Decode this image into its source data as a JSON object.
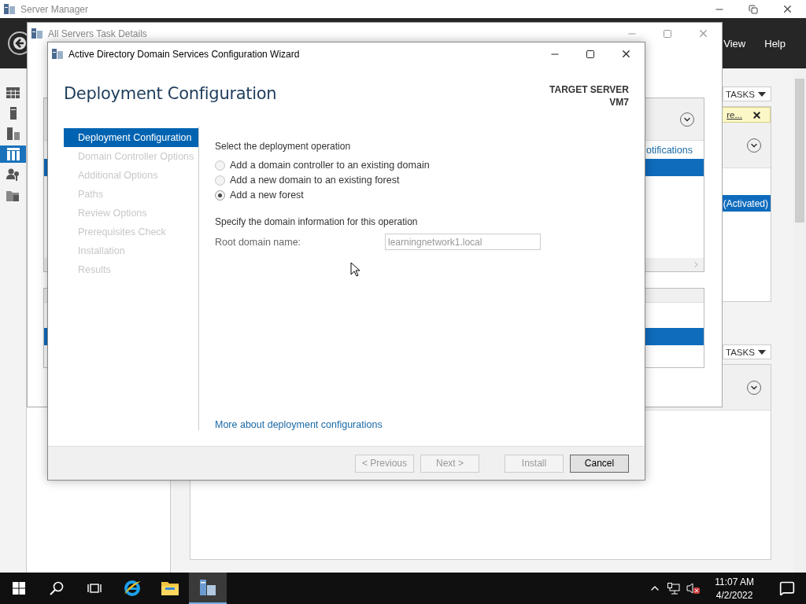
{
  "server_manager": {
    "title": "Server Manager",
    "menu": [
      "View",
      "Help"
    ],
    "nav_items": [
      {
        "kind": "dashboard",
        "selected": false
      },
      {
        "kind": "server",
        "selected": false
      },
      {
        "kind": "servers",
        "selected": false
      },
      {
        "kind": "directory",
        "selected": true
      },
      {
        "kind": "users",
        "selected": false
      },
      {
        "kind": "files",
        "selected": false
      }
    ],
    "tiles": [
      {
        "tasks": "TASKS",
        "notice": "re...",
        "highlight": "(Activated)"
      },
      {
        "tasks": "TASKS"
      }
    ]
  },
  "task_details": {
    "title": "All Servers Task Details",
    "link": "otifications"
  },
  "wizard": {
    "title": "Active Directory Domain Services Configuration Wizard",
    "heading": "Deployment Configuration",
    "target_label": "TARGET SERVER",
    "target_name": "VM7",
    "steps": [
      {
        "label": "Deployment Configuration",
        "selected": true,
        "disabled": false
      },
      {
        "label": "Domain Controller Options",
        "selected": false,
        "disabled": true
      },
      {
        "label": "Additional Options",
        "selected": false,
        "disabled": true
      },
      {
        "label": "Paths",
        "selected": false,
        "disabled": true
      },
      {
        "label": "Review Options",
        "selected": false,
        "disabled": true
      },
      {
        "label": "Prerequisites Check",
        "selected": false,
        "disabled": true
      },
      {
        "label": "Installation",
        "selected": false,
        "disabled": true
      },
      {
        "label": "Results",
        "selected": false,
        "disabled": true
      }
    ],
    "operation_label": "Select the deployment operation",
    "operations": [
      {
        "label": "Add a domain controller to an existing domain",
        "selected": false
      },
      {
        "label": "Add a new domain to an existing forest",
        "selected": false
      },
      {
        "label": "Add a new forest",
        "selected": true
      }
    ],
    "domain_label": "Specify the domain information for this operation",
    "root_label": "Root domain name:",
    "root_value": "learningnetwork1.local",
    "link": "More about deployment configurations",
    "buttons": [
      {
        "label": "< Previous",
        "disabled": true
      },
      {
        "label": "Next >",
        "disabled": true
      },
      {
        "label": "Install",
        "disabled": true
      },
      {
        "label": "Cancel",
        "disabled": false
      }
    ]
  },
  "taskbar": {
    "apps": [
      {
        "kind": "browser",
        "active": false
      },
      {
        "kind": "explorer",
        "active": false
      },
      {
        "kind": "server-manager",
        "active": true
      }
    ],
    "time": "11:07 AM",
    "date": "4/2/2022"
  }
}
